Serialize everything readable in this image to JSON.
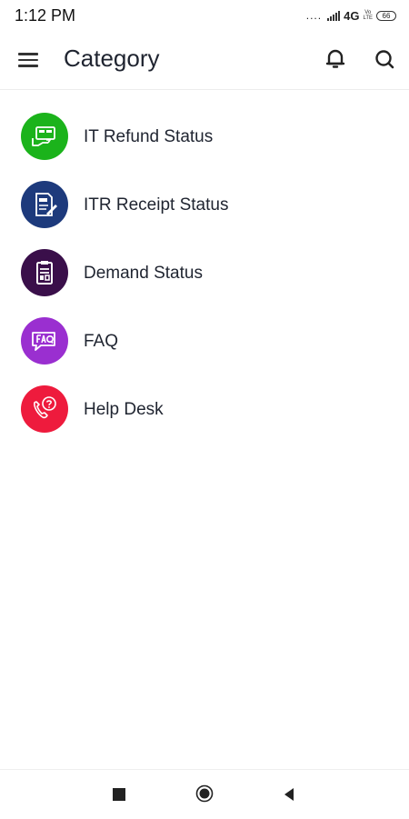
{
  "status_bar": {
    "time": "1:12 PM",
    "dots": "....",
    "network": "4G",
    "volte_top": "Vo",
    "volte_bottom": "LTE",
    "battery": "66"
  },
  "header": {
    "title": "Category"
  },
  "categories": [
    {
      "label": "IT Refund Status",
      "icon": "refund-icon",
      "color": "#1bb31b"
    },
    {
      "label": "ITR Receipt Status",
      "icon": "receipt-icon",
      "color": "#1d3a7c"
    },
    {
      "label": "Demand Status",
      "icon": "demand-icon",
      "color": "#3a0f4a"
    },
    {
      "label": "FAQ",
      "icon": "faq-icon",
      "color": "#9a2fd0"
    },
    {
      "label": "Help Desk",
      "icon": "help-desk-icon",
      "color": "#ee1b3d"
    }
  ],
  "nav": {
    "icons": [
      "recent-apps-icon",
      "home-icon",
      "back-icon"
    ]
  }
}
